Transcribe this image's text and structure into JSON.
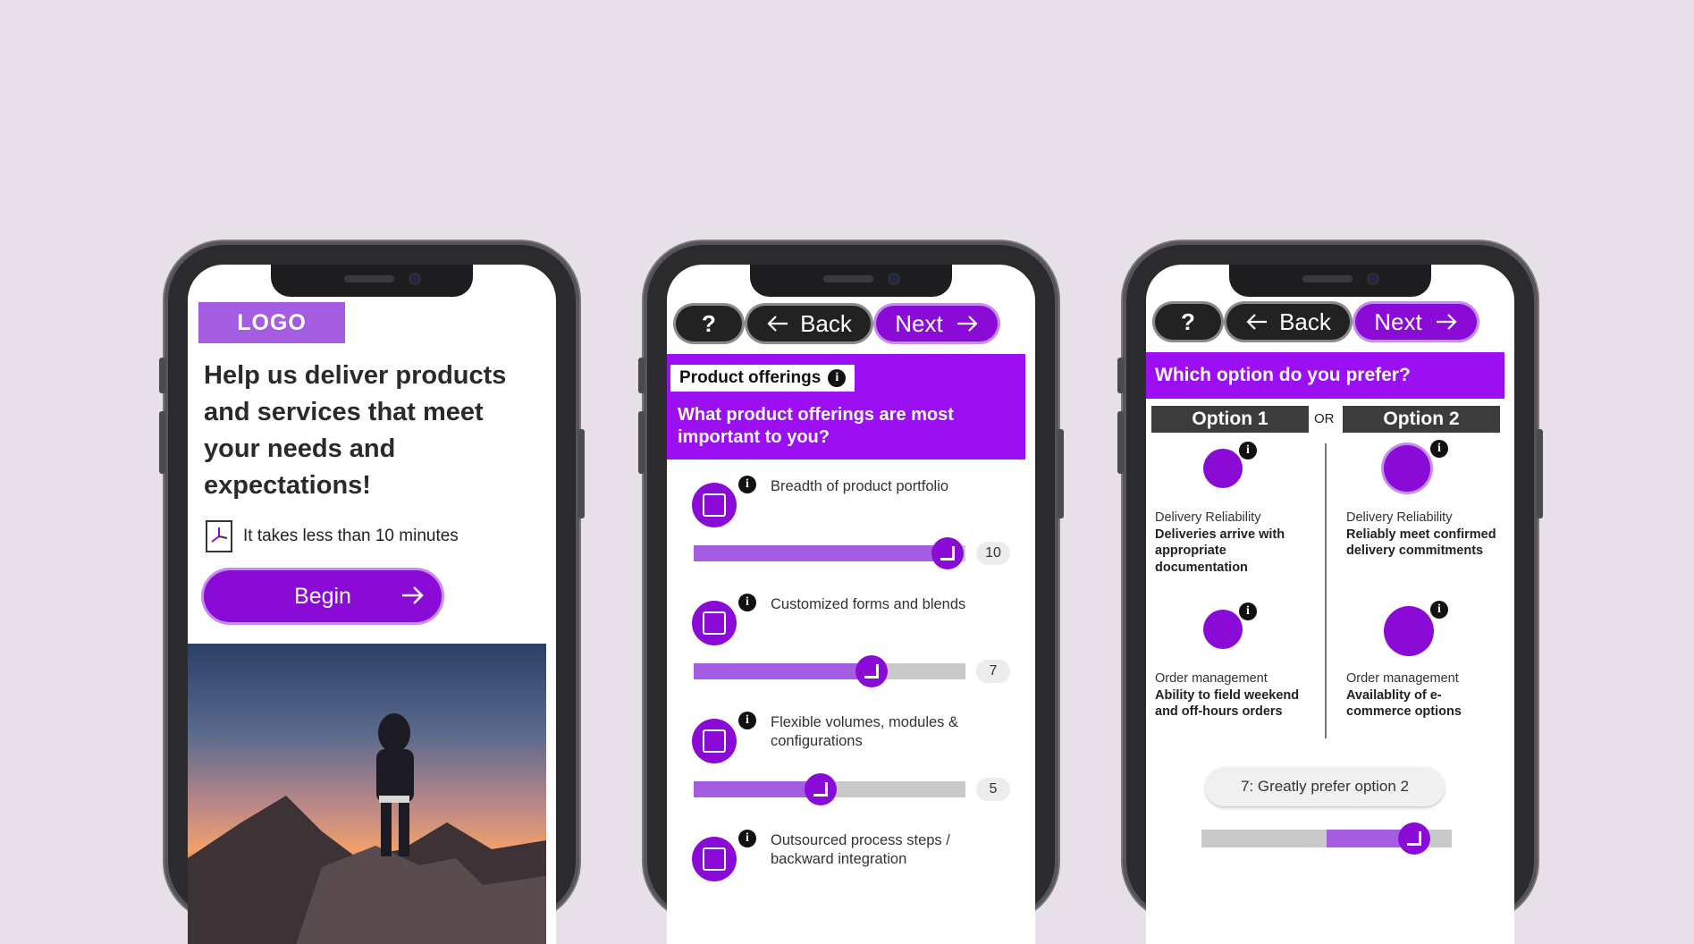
{
  "phone1": {
    "logo": "LOGO",
    "headline": "Help us deliver products and services that meet your needs and expectations!",
    "time_note": "It takes less than 10 minutes",
    "begin_label": "Begin"
  },
  "nav": {
    "help_label": "?",
    "back_label": "Back",
    "next_label": "Next"
  },
  "phone2": {
    "section_tag": "Product offerings",
    "question": "What product offerings are most important to you?",
    "items": [
      {
        "label": "Breadth of product portfolio",
        "value": "10",
        "fraction": 1.0
      },
      {
        "label": "Customized forms and blends",
        "value": "7",
        "fraction": 0.7
      },
      {
        "label": "Flexible volumes, modules & configurations",
        "value": "5",
        "fraction": 0.5
      },
      {
        "label": "Outsourced process steps / backward integration",
        "value": "",
        "fraction": 0
      }
    ]
  },
  "phone3": {
    "question": "Which option do you prefer?",
    "option1": "Option 1",
    "or": "OR",
    "option2": "Option 2",
    "row1": {
      "left_category": "Delivery Reliability",
      "left_text": "Deliveries arrive with appropriate documentation",
      "right_category": "Delivery Reliability",
      "right_text": "Reliably meet confirmed delivery commitments"
    },
    "row2": {
      "left_category": "Order management",
      "left_text": "Ability to field weekend and off-hours orders",
      "right_category": "Order management",
      "right_text": "Availablity of e-commerce options"
    },
    "preference_label": "7: Greatly prefer option 2",
    "preference_fraction": 0.85
  },
  "colors": {
    "accent": "#8a0bd6",
    "accent_light": "#a45de0",
    "header_purple": "#9b0ff2",
    "background": "#e7e0e8"
  }
}
